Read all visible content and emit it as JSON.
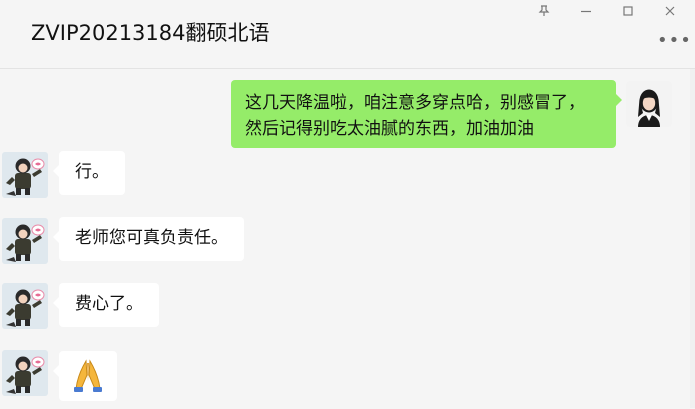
{
  "window": {
    "title": "ZVIP20213184翻硕北语",
    "pin_icon": "pin-icon",
    "minimize_icon": "minimize-icon",
    "maximize_icon": "maximize-icon",
    "close_icon": "close-icon",
    "more_icon": "more-options-icon"
  },
  "messages": [
    {
      "sender": "me",
      "text_line1": "这几天降温啦，咱注意多穿点哈，别感冒了，",
      "text_line2": "然后记得别吃太油腻的东西，加油加油"
    },
    {
      "sender": "contact",
      "text": "行。"
    },
    {
      "sender": "contact",
      "text": "老师您可真负责任。"
    },
    {
      "sender": "contact",
      "text": "费心了。"
    },
    {
      "sender": "contact",
      "emoji": "🙏"
    }
  ],
  "colors": {
    "background": "#f5f5f5",
    "outgoing_bubble": "#95ec69",
    "incoming_bubble": "#ffffff"
  }
}
